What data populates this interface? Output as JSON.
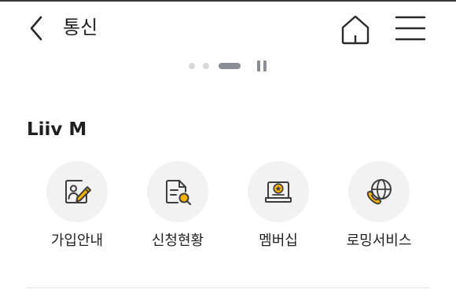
{
  "header": {
    "title": "통신",
    "back_icon": "chevron-left-icon",
    "home_icon": "home-icon",
    "menu_icon": "hamburger-menu-icon"
  },
  "carousel": {
    "total_pages": 3,
    "active_page": 3,
    "control_icon": "pause-icon"
  },
  "section": {
    "title": "Liiv M"
  },
  "menu_items": [
    {
      "label": "가입안내",
      "icon": "signup-profile-pencil-icon"
    },
    {
      "label": "신청현황",
      "icon": "document-search-icon"
    },
    {
      "label": "멤버십",
      "icon": "membership-star-icon"
    },
    {
      "label": "로밍서비스",
      "icon": "globe-phone-icon"
    }
  ],
  "colors": {
    "accent": "#f5b300",
    "icon_stroke": "#3c3c3c",
    "icon_bg": "#f2f2f2",
    "indicator_active": "#8a8e94",
    "indicator_inactive": "#d9d9d9"
  }
}
